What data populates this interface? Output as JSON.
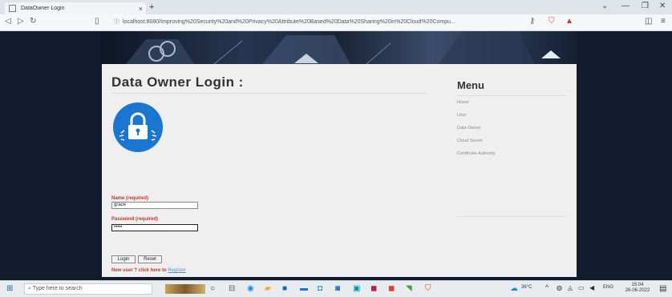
{
  "browser": {
    "tab_title": "DataOwner Login",
    "url": "localhost:8080/Improving%20Security%20and%20Privacy%20Attribute%20Based%20Data%20Sharing%20in%20Cloud%20Compu...",
    "close_glyph": "×",
    "newtab_glyph": "+"
  },
  "page": {
    "heading": "Data Owner Login :",
    "name_label": "Name (required)",
    "name_value": "grace",
    "password_label": "Password (required)",
    "password_value": "•••••",
    "login_button": "Login",
    "reset_button": "Reset",
    "new_user_text": "New user ? click here to",
    "register_link": "Register"
  },
  "menu": {
    "title": "Menu",
    "items": [
      "Home",
      "User",
      "Data Owner",
      "Cloud Server",
      "Certificate Authority"
    ]
  },
  "taskbar": {
    "search_placeholder": "Type here to search",
    "weather": "36°C",
    "lang": "ENG",
    "time": "15:04",
    "date": "26-06-2022"
  },
  "colors": {
    "accent": "#1976d2",
    "label_red": "#c0392b",
    "page_bg": "#141a2e",
    "content_bg": "#efefef"
  }
}
